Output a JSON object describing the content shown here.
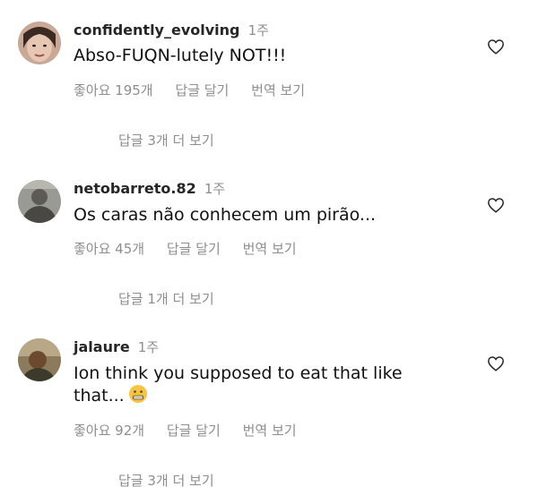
{
  "comments": [
    {
      "username": "confidently_evolving",
      "time": "1주",
      "text": "Abso-FUQN-lutely NOT!!!",
      "likes": "좋아요 195개",
      "reply": "답글 달기",
      "translate": "번역 보기",
      "more_replies": "답글 3개 더 보기",
      "avatar_icon": "profile-photo"
    },
    {
      "username": "netobarreto.82",
      "time": "1주",
      "text": "Os caras não conhecem um pirão...",
      "likes": "좋아요 45개",
      "reply": "답글 달기",
      "translate": "번역 보기",
      "more_replies": "답글 1개 더 보기",
      "avatar_icon": "profile-photo"
    },
    {
      "username": "jalaure",
      "time": "1주",
      "text": "Ion think you supposed to eat that like that...",
      "emoji": "grimacing-face-emoji",
      "likes": "좋아요 92개",
      "reply": "답글 달기",
      "translate": "번역 보기",
      "more_replies": "답글 3개 더 보기",
      "avatar_icon": "profile-photo"
    }
  ],
  "colors": {
    "primary_text": "#111111",
    "secondary_text": "#8e8e8e",
    "background": "#ffffff"
  }
}
